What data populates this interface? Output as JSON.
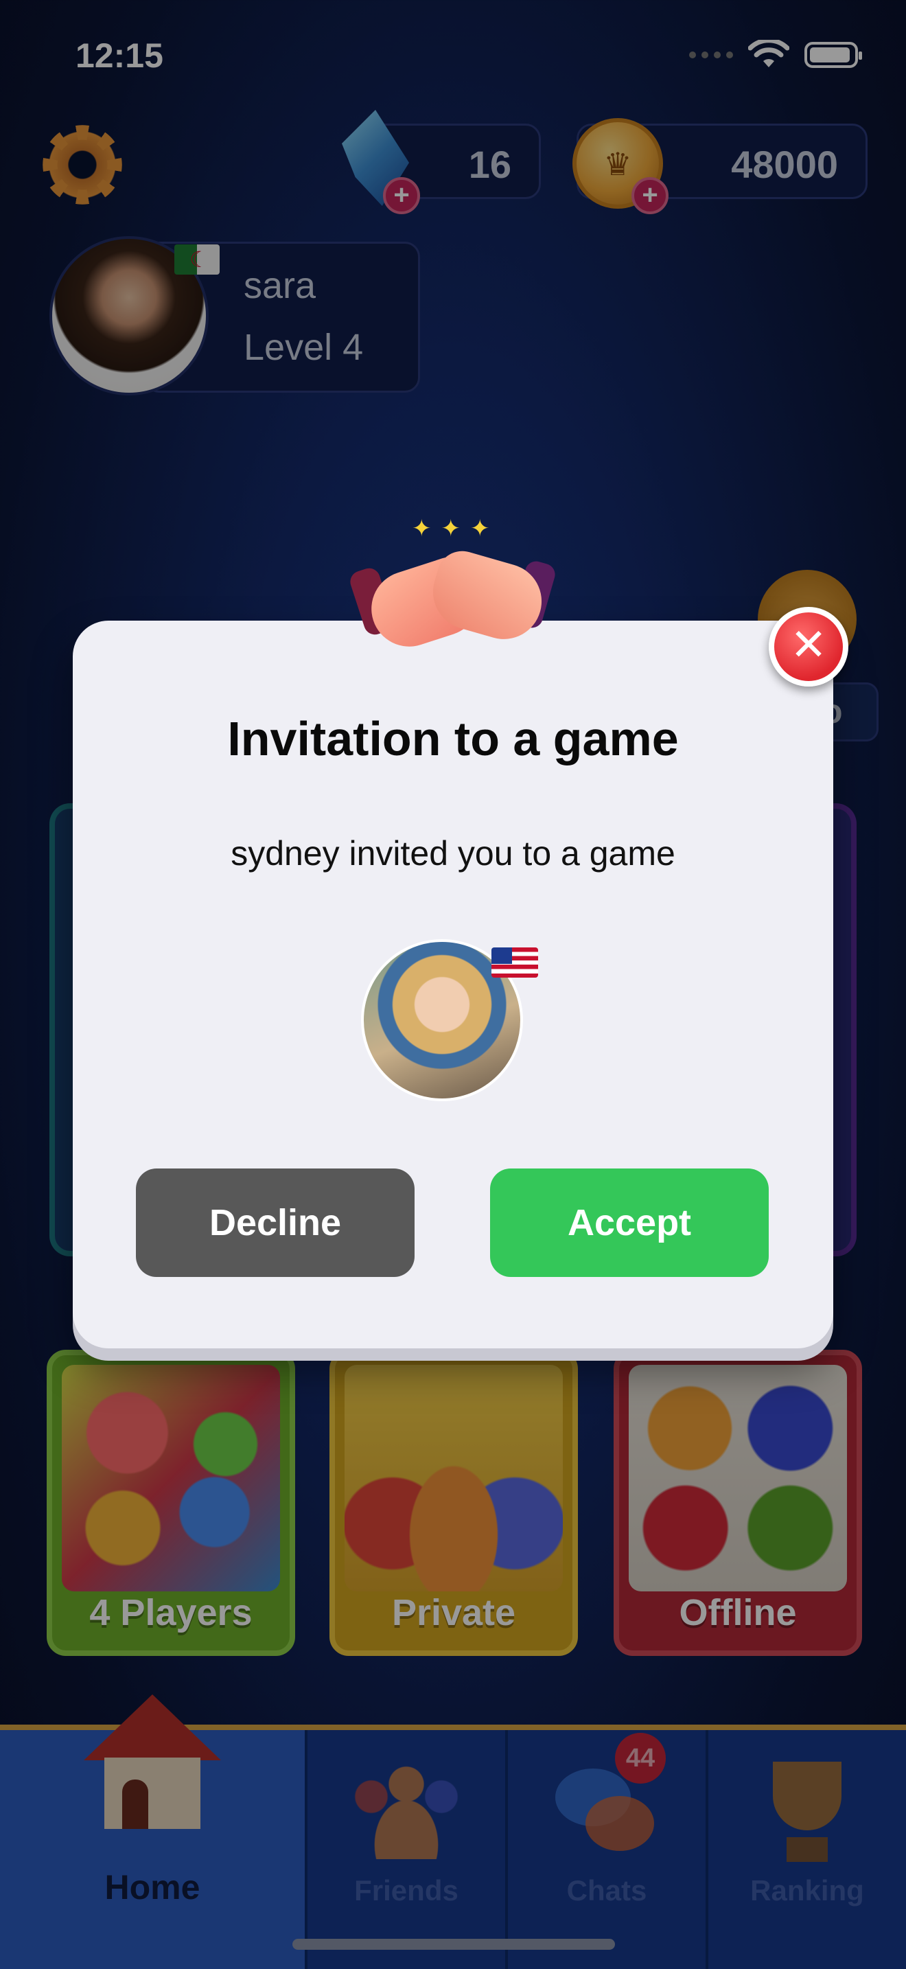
{
  "status_bar": {
    "time": "12:15"
  },
  "currency": {
    "gems": "16",
    "coins": "48000",
    "plus": "+"
  },
  "profile": {
    "name": "sara",
    "level": "Level 4"
  },
  "game_modes": [
    {
      "label": "4 Players"
    },
    {
      "label": "Private"
    },
    {
      "label": "Offline"
    }
  ],
  "tabs": [
    {
      "label": "Home",
      "active": true
    },
    {
      "label": "Friends"
    },
    {
      "label": "Chats",
      "badge": "44"
    },
    {
      "label": "Ranking"
    }
  ],
  "dialog": {
    "title": "Invitation to a game",
    "message": "sydney invited you to a game",
    "decline_label": "Decline",
    "accept_label": "Accept",
    "close_symbol": "✕"
  },
  "colors": {
    "accept": "#34c759",
    "decline": "#585858",
    "close": "#e0262e",
    "dialog_bg": "#efeff5",
    "tab_bar": "#173a8c"
  },
  "icons": [
    "settings-gear-icon",
    "gem-icon",
    "coin-icon",
    "handshake-icon",
    "close-icon",
    "house-icon",
    "friends-icon",
    "chats-icon",
    "trophy-icon",
    "wifi-icon",
    "battery-icon"
  ]
}
